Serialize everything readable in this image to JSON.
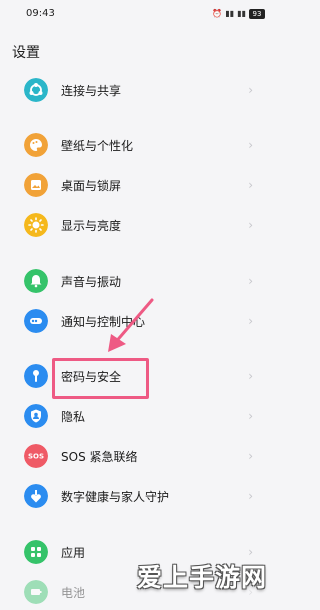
{
  "status_bar": {
    "time": "09:43",
    "alarm_icon": "alarm-clock-icon",
    "signal_icons": [
      "signal-icon",
      "signal-icon"
    ],
    "battery": "93"
  },
  "page_title": "设置",
  "items": [
    {
      "label": "连接与共享",
      "icon": "share-icon",
      "color": "#2bb6c9"
    },
    {
      "label": "壁纸与个性化",
      "icon": "palette-icon",
      "color": "#f1a238"
    },
    {
      "label": "桌面与锁屏",
      "icon": "image-icon",
      "color": "#f1a238"
    },
    {
      "label": "显示与亮度",
      "icon": "sun-icon",
      "color": "#f5b81c"
    },
    {
      "label": "声音与振动",
      "icon": "bell-icon",
      "color": "#35c36a"
    },
    {
      "label": "通知与控制中心",
      "icon": "notification-icon",
      "color": "#2b8cf0"
    },
    {
      "label": "密码与安全",
      "icon": "key-icon",
      "color": "#2b8cf0"
    },
    {
      "label": "隐私",
      "icon": "privacy-icon",
      "color": "#2b8cf0"
    },
    {
      "label": "SOS 紧急联络",
      "icon": "sos-icon",
      "color": "#ef5a66"
    },
    {
      "label": "数字健康与家人守护",
      "icon": "heart-shield-icon",
      "color": "#2b8cf0"
    },
    {
      "label": "应用",
      "icon": "apps-icon",
      "color": "#35c36a"
    },
    {
      "label": "电池",
      "icon": "battery-icon",
      "color": "#35c36a"
    }
  ],
  "chevron": "›",
  "highlight_color": "#ee5a84",
  "watermark": "爱上手游网"
}
